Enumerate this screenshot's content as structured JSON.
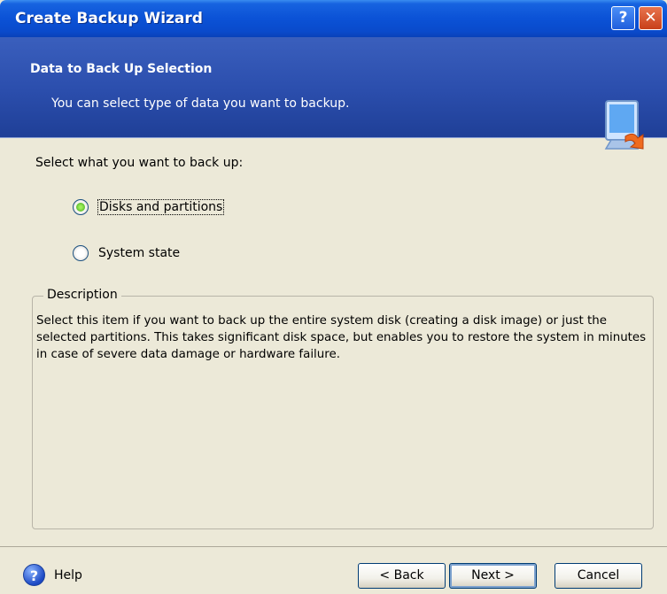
{
  "window": {
    "title": "Create Backup Wizard",
    "help_button": "?",
    "close_button": "✕"
  },
  "header": {
    "title": "Data to Back Up Selection",
    "subtitle": "You can select type of data you want to backup."
  },
  "body": {
    "prompt": "Select what you want to back up:",
    "options": [
      {
        "label": "Disks and partitions",
        "selected": true
      },
      {
        "label": "System state",
        "selected": false
      }
    ],
    "description_legend": "Description",
    "description_text": "Select this item if you want to back up the entire system disk (creating a disk image) or just the selected partitions. This takes significant disk space, but enables you to restore the system in minutes in case of severe data damage or hardware failure."
  },
  "footer": {
    "help_label": "Help",
    "help_glyph": "?",
    "back_label": "< Back",
    "next_label": "Next >",
    "cancel_label": "Cancel"
  },
  "colors": {
    "titlebar": "#0b52d6",
    "header": "#2c4fae",
    "dialog_bg": "#ece9d8",
    "radio_checked": "#3aa11a"
  },
  "icons": {
    "header_icon": "computer-monitor-arrow-icon",
    "help_icon": "question-circle-icon"
  }
}
